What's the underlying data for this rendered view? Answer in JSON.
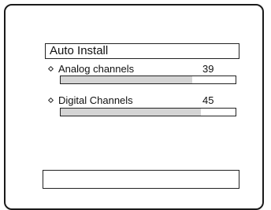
{
  "dialog": {
    "title": "Auto Install"
  },
  "channels": [
    {
      "label": "Analog channels",
      "count": "39",
      "progress_percent": 75
    },
    {
      "label": "Digital Channels",
      "count": "45",
      "progress_percent": 80
    }
  ],
  "colors": {
    "border": "#1a1a1a",
    "bar_fill": "#d4d4d4",
    "background": "#ffffff"
  },
  "icons": {
    "bullet": "diamond-bullet-icon"
  }
}
